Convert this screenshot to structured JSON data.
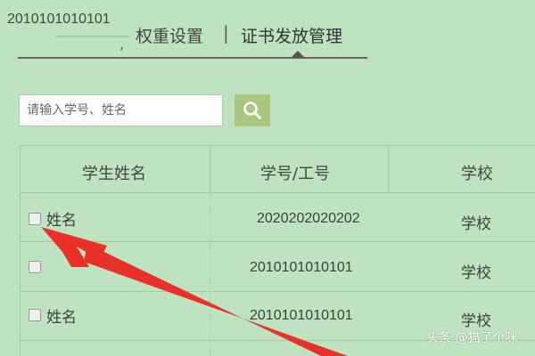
{
  "header": {
    "id_number": "2010101010101"
  },
  "tabs": [
    {
      "label": "权重设置"
    },
    {
      "label": "证书发放管理",
      "active": true
    }
  ],
  "tab_separator": "|",
  "tab_comma": ",",
  "search": {
    "placeholder": "请输入学号、姓名",
    "icon": "search-icon"
  },
  "table": {
    "columns": [
      "学生姓名",
      "学号/工号",
      "学校"
    ],
    "rows": [
      {
        "name": "姓名",
        "id": "2020202020202",
        "school": "学校"
      },
      {
        "name": "",
        "id": "2010101010101",
        "school": "学校"
      },
      {
        "name": "姓名",
        "id": "2010101010101",
        "school": "学校"
      }
    ]
  },
  "watermark": "头条 @猫了个咪",
  "colors": {
    "background": "#bfe3c1",
    "search_button": "#a9c57f",
    "arrow": "#e8312a",
    "grid": "#a9c5aa"
  }
}
